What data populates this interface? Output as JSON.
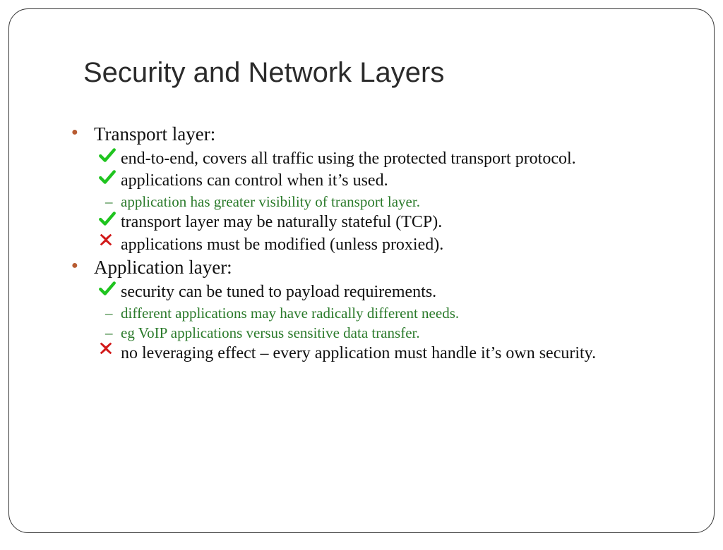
{
  "title": "Security and Network Layers",
  "sections": [
    {
      "heading": "Transport layer:",
      "items": [
        {
          "type": "check",
          "text": "end-to-end, covers all traffic using the protected transport protocol."
        },
        {
          "type": "check",
          "text": "applications can control when it’s used."
        },
        {
          "type": "dash",
          "text": "application has greater visibility of transport layer."
        },
        {
          "type": "check",
          "text": "transport layer may be naturally stateful (TCP)."
        },
        {
          "type": "cross",
          "text": "applications must be modified (unless proxied)."
        }
      ]
    },
    {
      "heading": "Application layer:",
      "items": [
        {
          "type": "check",
          "text": "security can be tuned to payload requirements."
        },
        {
          "type": "dash",
          "text": "different applications may have radically different needs."
        },
        {
          "type": "dash",
          "text": "eg VoIP applications versus sensitive data transfer."
        },
        {
          "type": "cross",
          "text": "no leveraging effect – every application must handle it’s own security."
        }
      ]
    }
  ]
}
